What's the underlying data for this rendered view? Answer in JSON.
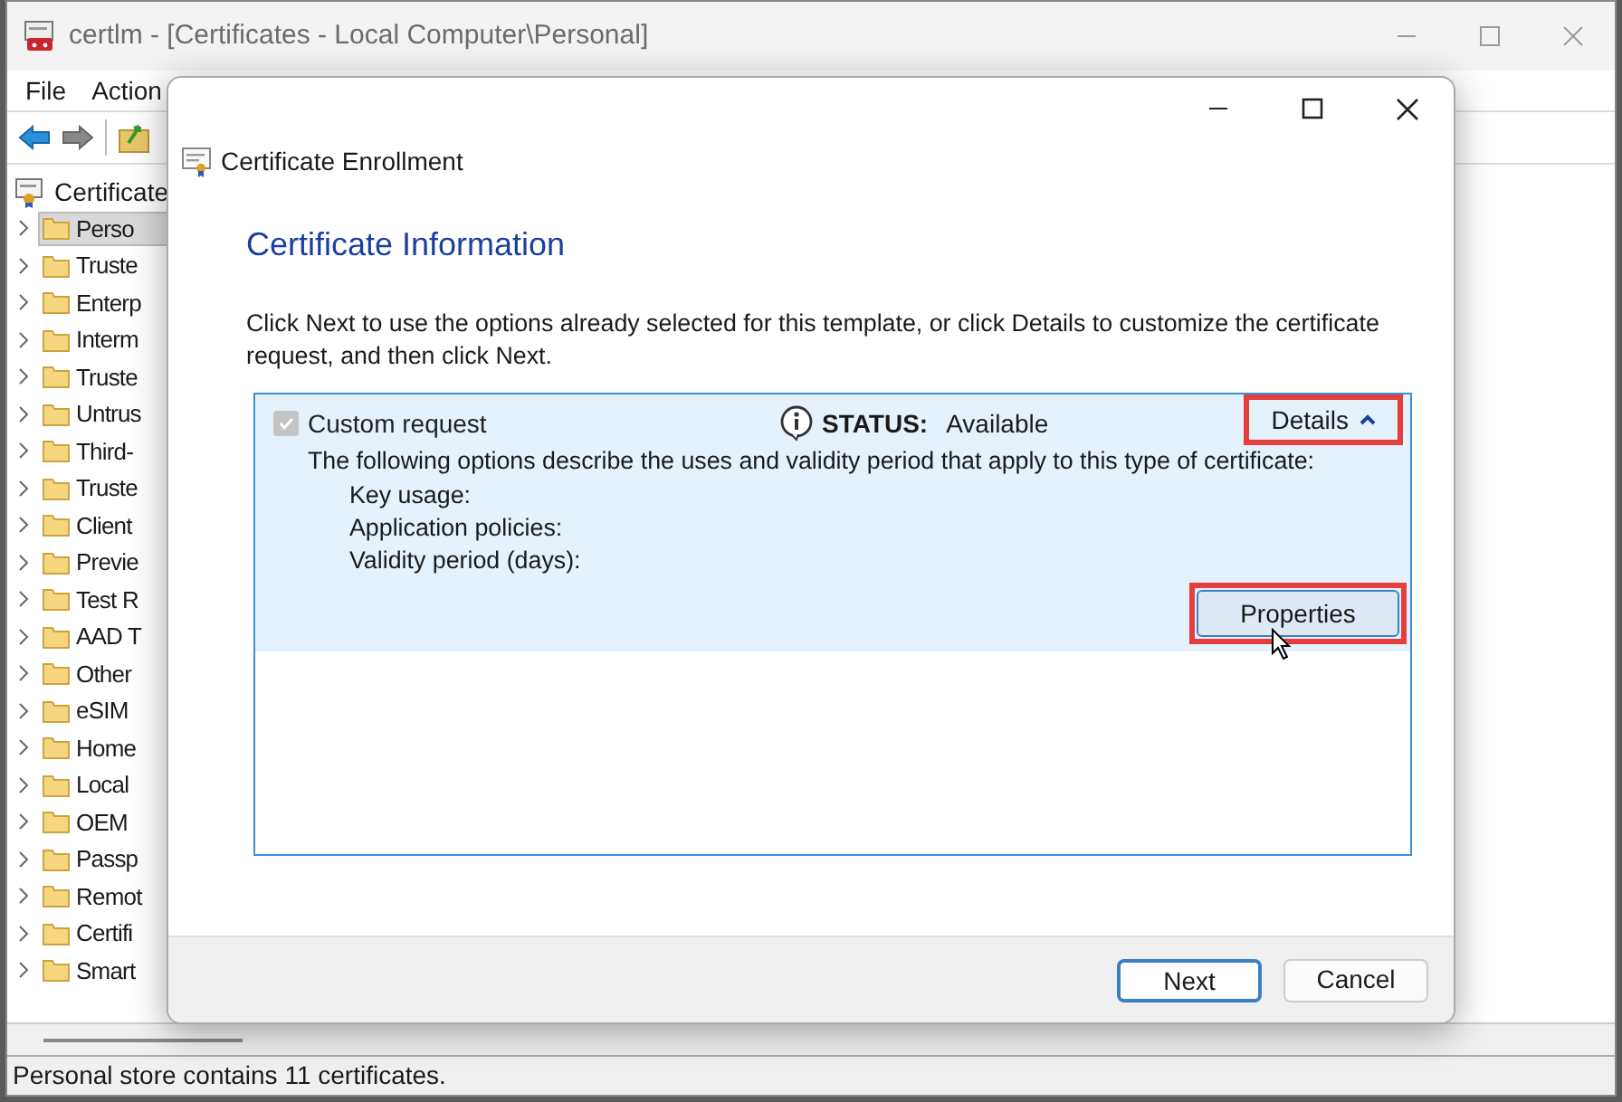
{
  "window": {
    "title": "certlm - [Certificates - Local Computer\\Personal]"
  },
  "menu": [
    "File",
    "Action"
  ],
  "tree": {
    "root": "Certificate",
    "items": [
      {
        "label": "Perso",
        "selected": true,
        "expanded": false
      },
      {
        "label": "Truste",
        "selected": false,
        "expanded": false
      },
      {
        "label": "Enterp",
        "selected": false,
        "expanded": false
      },
      {
        "label": "Interm",
        "selected": false,
        "expanded": false
      },
      {
        "label": "Truste",
        "selected": false,
        "expanded": false
      },
      {
        "label": "Untrus",
        "selected": false,
        "expanded": false
      },
      {
        "label": "Third-",
        "selected": false,
        "expanded": false
      },
      {
        "label": "Truste",
        "selected": false,
        "expanded": false
      },
      {
        "label": "Client",
        "selected": false,
        "expanded": false
      },
      {
        "label": "Previe",
        "selected": false,
        "expanded": false
      },
      {
        "label": "Test R",
        "selected": false,
        "expanded": false
      },
      {
        "label": "AAD T",
        "selected": false,
        "expanded": false
      },
      {
        "label": "Other",
        "selected": false,
        "expanded": false
      },
      {
        "label": "eSIM",
        "selected": false,
        "expanded": false
      },
      {
        "label": "Home",
        "selected": false,
        "expanded": false
      },
      {
        "label": "Local",
        "selected": false,
        "expanded": false
      },
      {
        "label": "OEM",
        "selected": false,
        "expanded": false
      },
      {
        "label": "Passp",
        "selected": false,
        "expanded": false
      },
      {
        "label": "Remot",
        "selected": false,
        "expanded": false
      },
      {
        "label": "Certifi",
        "selected": false,
        "expanded": false
      },
      {
        "label": "Smart",
        "selected": false,
        "expanded": false
      }
    ]
  },
  "status_bar": "Personal store contains 11 certificates.",
  "dialog": {
    "title": "Certificate Enrollment",
    "heading": "Certificate Information",
    "intro": "Click Next to use the options already selected for this template, or click Details to customize the certificate request, and then click Next.",
    "request": {
      "label": "Custom request",
      "checked": true,
      "disabled": true,
      "status_label": "STATUS:",
      "status": "Available",
      "details_link": "Details",
      "expanded": true,
      "description": "The following options describe the uses and validity period that apply to this type of certificate:",
      "fields": [
        "Key usage:",
        "Application policies:",
        "Validity period (days):"
      ],
      "properties_button": "Properties"
    },
    "buttons": [
      {
        "label": "Next",
        "default": true
      },
      {
        "label": "Cancel",
        "default": false
      }
    ]
  }
}
